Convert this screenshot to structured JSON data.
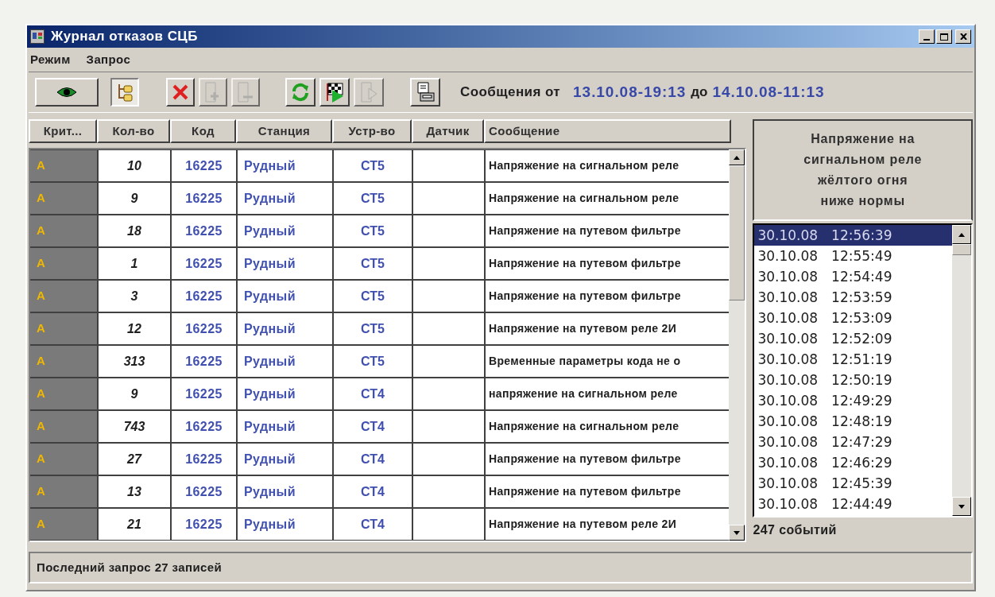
{
  "window": {
    "title": "Журнал отказов СЦБ"
  },
  "menu": [
    "Режим",
    "Запрос"
  ],
  "toolbar": {
    "buttons": [
      {
        "kind": "eye",
        "pressed": false,
        "disabled": false
      },
      {
        "kind": "tree",
        "pressed": true,
        "disabled": false
      },
      {
        "kind": "delete",
        "pressed": false,
        "disabled": false
      },
      {
        "kind": "add",
        "pressed": false,
        "disabled": true
      },
      {
        "kind": "remove",
        "pressed": false,
        "disabled": true
      },
      {
        "kind": "refresh",
        "pressed": false,
        "disabled": false
      },
      {
        "kind": "flag",
        "pressed": false,
        "disabled": false
      },
      {
        "kind": "play",
        "pressed": false,
        "disabled": true
      },
      {
        "kind": "print",
        "pressed": false,
        "disabled": false
      }
    ],
    "range": {
      "label": "Сообщения от",
      "from": "13.10.08-19:13",
      "to_label": "до",
      "to": "14.10.08-11:13"
    }
  },
  "table": {
    "columns": [
      "Крит...",
      "Кол-во",
      "Код",
      "Станция",
      "Устр-во",
      "Датчик",
      "Сообщение"
    ],
    "rows": [
      {
        "crit": "A",
        "count": "10",
        "code": "16225",
        "station": "Рудный",
        "device": "СТ5",
        "message": "Напряжение на сигнальном реле"
      },
      {
        "crit": "A",
        "count": "9",
        "code": "16225",
        "station": "Рудный",
        "device": "СТ5",
        "message": "Напряжение на сигнальном реле"
      },
      {
        "crit": "A",
        "count": "18",
        "code": "16225",
        "station": "Рудный",
        "device": "СТ5",
        "message": "Напряжение на путевом фильтре"
      },
      {
        "crit": "A",
        "count": "1",
        "code": "16225",
        "station": "Рудный",
        "device": "СТ5",
        "message": "Напряжение на путевом фильтре"
      },
      {
        "crit": "A",
        "count": "3",
        "code": "16225",
        "station": "Рудный",
        "device": "СТ5",
        "message": "Напряжение на путевом фильтре"
      },
      {
        "crit": "A",
        "count": "12",
        "code": "16225",
        "station": "Рудный",
        "device": "СТ5",
        "message": "Напряжение на путевом реле 2И"
      },
      {
        "crit": "A",
        "count": "313",
        "code": "16225",
        "station": "Рудный",
        "device": "СТ5",
        "message": "Временные параметры кода не о"
      },
      {
        "crit": "A",
        "count": "9",
        "code": "16225",
        "station": "Рудный",
        "device": "СТ4",
        "message": "напряжение на сигнальном реле"
      },
      {
        "crit": "A",
        "count": "743",
        "code": "16225",
        "station": "Рудный",
        "device": "СТ4",
        "message": "Напряжение на сигнальном реле"
      },
      {
        "crit": "A",
        "count": "27",
        "code": "16225",
        "station": "Рудный",
        "device": "СТ4",
        "message": "Напряжение на путевом фильтре"
      },
      {
        "crit": "A",
        "count": "13",
        "code": "16225",
        "station": "Рудный",
        "device": "СТ4",
        "message": "Напряжение на путевом фильтре"
      },
      {
        "crit": "A",
        "count": "21",
        "code": "16225",
        "station": "Рудный",
        "device": "СТ4",
        "message": "Напряжение на путевом реле 2И"
      }
    ]
  },
  "details": {
    "title_lines": [
      "Напряжение на",
      "сигнальном реле",
      "жёлтого огня",
      "ниже нормы"
    ],
    "events": [
      {
        "date": "30.10.08",
        "time": "12:56:39",
        "selected": true
      },
      {
        "date": "30.10.08",
        "time": "12:55:49",
        "selected": false
      },
      {
        "date": "30.10.08",
        "time": "12:54:49",
        "selected": false
      },
      {
        "date": "30.10.08",
        "time": "12:53:59",
        "selected": false
      },
      {
        "date": "30.10.08",
        "time": "12:53:09",
        "selected": false
      },
      {
        "date": "30.10.08",
        "time": "12:52:09",
        "selected": false
      },
      {
        "date": "30.10.08",
        "time": "12:51:19",
        "selected": false
      },
      {
        "date": "30.10.08",
        "time": "12:50:19",
        "selected": false
      },
      {
        "date": "30.10.08",
        "time": "12:49:29",
        "selected": false
      },
      {
        "date": "30.10.08",
        "time": "12:48:19",
        "selected": false
      },
      {
        "date": "30.10.08",
        "time": "12:47:29",
        "selected": false
      },
      {
        "date": "30.10.08",
        "time": "12:46:29",
        "selected": false
      },
      {
        "date": "30.10.08",
        "time": "12:45:39",
        "selected": false
      },
      {
        "date": "30.10.08",
        "time": "12:44:49",
        "selected": false
      }
    ],
    "count": "247 событий"
  },
  "status_bar": "Последний запрос 27 записей"
}
